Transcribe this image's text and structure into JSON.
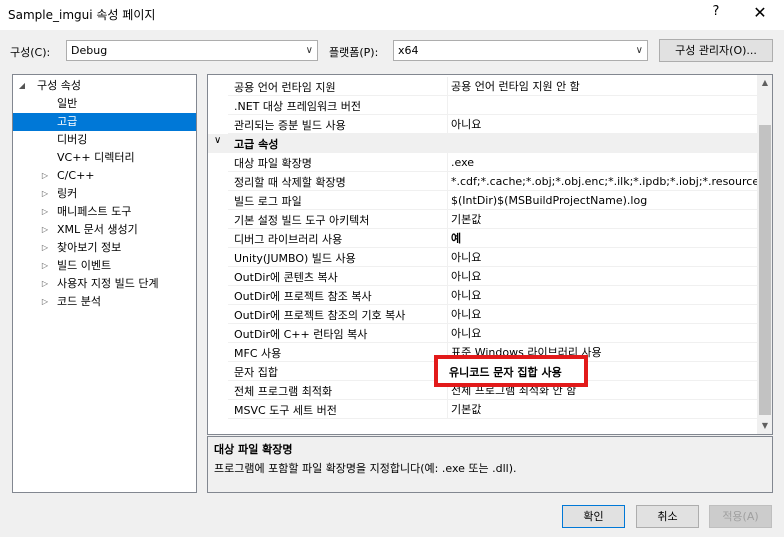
{
  "window": {
    "title": "Sample_imgui 속성 페이지",
    "help_glyph": "?",
    "close_glyph": "✕"
  },
  "config_bar": {
    "config_label": "구성(C):",
    "config_value": "Debug",
    "platform_label": "플랫폼(P):",
    "platform_value": "x64",
    "manager_button": "구성 관리자(O)..."
  },
  "tree": {
    "items": [
      {
        "label": "구성 속성",
        "expander": "◢",
        "level": 0
      },
      {
        "label": "일반",
        "expander": "",
        "level": 1
      },
      {
        "label": "고급",
        "expander": "",
        "level": 1,
        "selected": true
      },
      {
        "label": "디버깅",
        "expander": "",
        "level": 1
      },
      {
        "label": "VC++ 디렉터리",
        "expander": "",
        "level": 1
      },
      {
        "label": "C/C++",
        "expander": "▷",
        "level": 1
      },
      {
        "label": "링커",
        "expander": "▷",
        "level": 1
      },
      {
        "label": "매니페스트 도구",
        "expander": "▷",
        "level": 1
      },
      {
        "label": "XML 문서 생성기",
        "expander": "▷",
        "level": 1
      },
      {
        "label": "찾아보기 정보",
        "expander": "▷",
        "level": 1
      },
      {
        "label": "빌드 이벤트",
        "expander": "▷",
        "level": 1
      },
      {
        "label": "사용자 지정 빌드 단계",
        "expander": "▷",
        "level": 1
      },
      {
        "label": "코드 분석",
        "expander": "▷",
        "level": 1
      }
    ]
  },
  "grid": {
    "rows": [
      {
        "name": "공용 언어 런타임 지원",
        "value": "공용 언어 런타임 지원 안 함"
      },
      {
        "name": ".NET 대상 프레임워크 버전",
        "value": ""
      },
      {
        "name": "관리되는 증분 빌드 사용",
        "value": "아니요"
      },
      {
        "name": "고급 속성",
        "value": "",
        "section": true
      },
      {
        "name": "대상 파일 확장명",
        "value": ".exe"
      },
      {
        "name": "정리할 때 삭제할 확장명",
        "value": "*.cdf;*.cache;*.obj;*.obj.enc;*.ilk;*.ipdb;*.iobj;*.resources;*.t"
      },
      {
        "name": "빌드 로그 파일",
        "value": "$(IntDir)$(MSBuildProjectName).log"
      },
      {
        "name": "기본 설정 빌드 도구 아키텍처",
        "value": "기본값"
      },
      {
        "name": "디버그 라이브러리 사용",
        "value": "예",
        "bold": true
      },
      {
        "name": "Unity(JUMBO) 빌드 사용",
        "value": "아니요"
      },
      {
        "name": "OutDir에 콘텐츠 복사",
        "value": "아니요"
      },
      {
        "name": "OutDir에 프로젝트 참조 복사",
        "value": "아니요"
      },
      {
        "name": "OutDir에 프로젝트 참조의 기호 복사",
        "value": "아니요"
      },
      {
        "name": "OutDir에 C++ 런타임 복사",
        "value": "아니요"
      },
      {
        "name": "MFC 사용",
        "value": "표준 Windows 라이브러리 사용"
      },
      {
        "name": "문자 집합",
        "value": ""
      },
      {
        "name": "전체 프로그램 최적화",
        "value": "전체 프로그램 최적화 안 함"
      },
      {
        "name": "MSVC 도구 세트 버전",
        "value": "기본값"
      }
    ],
    "section_chevron": "∨",
    "scroll_up": "▲",
    "scroll_down": "▼",
    "highlighted_value": "유니코드 문자 집합 사용"
  },
  "description": {
    "title": "대상 파일 확장명",
    "body": "프로그램에 포함할 파일 확장명을 지정합니다(예: .exe 또는 .dll)."
  },
  "buttons": {
    "ok": "확인",
    "cancel": "취소",
    "apply": "적용(A)"
  },
  "colors": {
    "selection": "#0078d7",
    "highlight_border": "#e21a1a"
  }
}
